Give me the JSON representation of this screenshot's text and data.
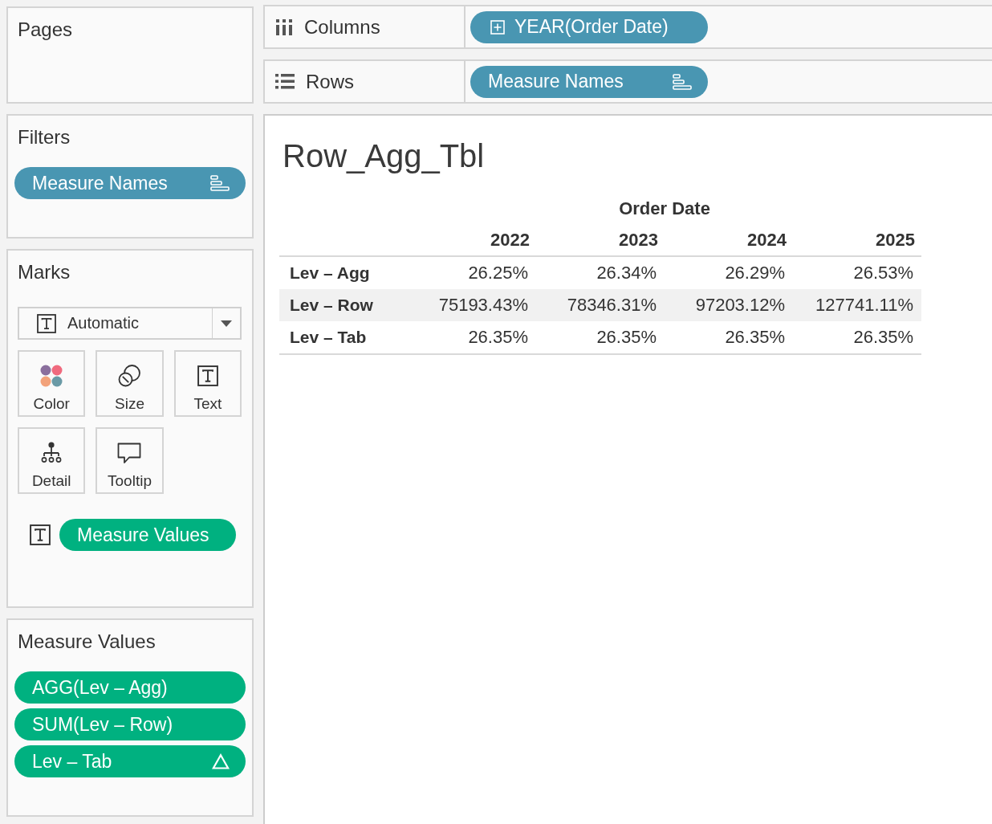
{
  "pages": {
    "title": "Pages"
  },
  "filters": {
    "title": "Filters",
    "pills": [
      {
        "text": "Measure Names",
        "continuous": false,
        "kind": "sorted"
      }
    ]
  },
  "marks": {
    "title": "Marks",
    "mark_type": "Automatic",
    "properties": [
      {
        "kind": "color",
        "label": "Color"
      },
      {
        "kind": "size",
        "label": "Size"
      },
      {
        "kind": "text",
        "label": "Text"
      },
      {
        "kind": "detail",
        "label": "Detail"
      },
      {
        "kind": "tooltip",
        "label": "Tooltip"
      }
    ],
    "encodings": [
      {
        "kind": "text",
        "pill": {
          "text": "Measure Values",
          "continuous": true
        }
      }
    ]
  },
  "measure_values": {
    "title": "Measure Values",
    "pills": [
      {
        "text": "AGG(Lev – Agg)",
        "continuous": true
      },
      {
        "text": "SUM(Lev – Row)",
        "continuous": true
      },
      {
        "text": "Lev – Tab",
        "continuous": true,
        "kind": "calculated"
      }
    ]
  },
  "shelves": [
    {
      "kind": "columns",
      "label": "Columns",
      "pill": {
        "text": "YEAR(Order Date)",
        "continuous": false,
        "kind": "expandable"
      }
    },
    {
      "kind": "rows",
      "label": "Rows",
      "pill": {
        "text": "Measure Names",
        "continuous": false,
        "kind": "sorted"
      }
    }
  ],
  "sheet": {
    "title": "Row_Agg_Tbl",
    "column_header": "Order Date",
    "columns": [
      "2022",
      "2023",
      "2024",
      "2025"
    ],
    "rows": [
      {
        "label": "Lev – Agg",
        "values": [
          "26.25%",
          "26.34%",
          "26.29%",
          "26.53%"
        ],
        "shaded": false
      },
      {
        "label": "Lev – Row",
        "values": [
          "75193.43%",
          "78346.31%",
          "97203.12%",
          "127741.11%"
        ],
        "shaded": true
      },
      {
        "label": "Lev – Tab",
        "values": [
          "26.35%",
          "26.35%",
          "26.35%",
          "26.35%"
        ],
        "shaded": false
      }
    ]
  }
}
